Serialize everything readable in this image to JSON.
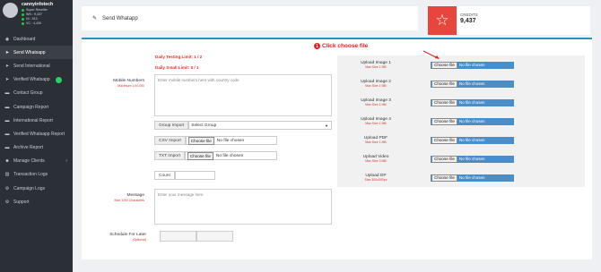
{
  "profile": {
    "name": "cannyinfotech",
    "role": "Super Reseller",
    "wa": "WN : 9,437",
    "ni": "NI : 513",
    "vc": "VC : 4,430"
  },
  "sidebar": {
    "items": [
      {
        "label": "Dashboard",
        "icon": "dashboard-icon"
      },
      {
        "label": "Send Whatsapp",
        "icon": "send-icon"
      },
      {
        "label": "Send International",
        "icon": "send-icon"
      },
      {
        "label": "Verified Whatsapp",
        "icon": "send-icon"
      },
      {
        "label": "Contact Group",
        "icon": "folder-icon"
      },
      {
        "label": "Campaign Report",
        "icon": "folder-icon"
      },
      {
        "label": "International Report",
        "icon": "folder-icon"
      },
      {
        "label": "Verified Whatsapp Report",
        "icon": "folder-icon"
      },
      {
        "label": "Archive Report",
        "icon": "folder-icon"
      },
      {
        "label": "Manage Clients",
        "icon": "users-icon"
      },
      {
        "label": "Transaction Logs",
        "icon": "chart-icon"
      },
      {
        "label": "Campaign Logs",
        "icon": "gear-icon"
      },
      {
        "label": "Support",
        "icon": "gear-icon"
      }
    ]
  },
  "header": {
    "title": "Send Whatapp"
  },
  "credits": {
    "label": "CREDITS",
    "value": "9,437"
  },
  "form": {
    "daily_testing": "Daily Testing Limit: 1 / 2",
    "daily_small": "Daily Small Limit: 0 / 1",
    "mobile_label": "Mobile Numbers",
    "mobile_sub": "Maximum 1,00,000",
    "mobile_placeholder": "Enter mobile numbers here with country code",
    "group_import": "Group Import",
    "group_select": "Select Group",
    "csv_import": "CSV Import",
    "txt_import": "TXT Import",
    "choose_file": "Choose file",
    "no_file": "No file chosen",
    "count": "Count",
    "message_label": "Message",
    "message_sub": "Max 1000 Characters",
    "message_placeholder": "Enter your message here",
    "schedule_label": "Schedule For Later",
    "schedule_sub": "(Optional)"
  },
  "uploads": [
    {
      "label": "Upload Image 1",
      "sub": "Max Size 1 MB"
    },
    {
      "label": "Upload Image 2",
      "sub": "Max Size 1 MB"
    },
    {
      "label": "Upload Image 3",
      "sub": "Max Size 1 MB"
    },
    {
      "label": "Upload Image 4",
      "sub": "Max Size 1 MB"
    },
    {
      "label": "Upload PDF",
      "sub": "Max Size 1 MB"
    },
    {
      "label": "Upload Video",
      "sub": "Max Size 3 MB"
    },
    {
      "label": "Upload DP",
      "sub": "Size 300x300px"
    }
  ],
  "callout": {
    "number": "1",
    "text": "Click choose file"
  },
  "colors": {
    "sidebar": "#2b2f36",
    "accent": "#2d8fbf",
    "credits": "#e8453c",
    "upload": "#4a8ec9",
    "warn": "#d9332a"
  }
}
